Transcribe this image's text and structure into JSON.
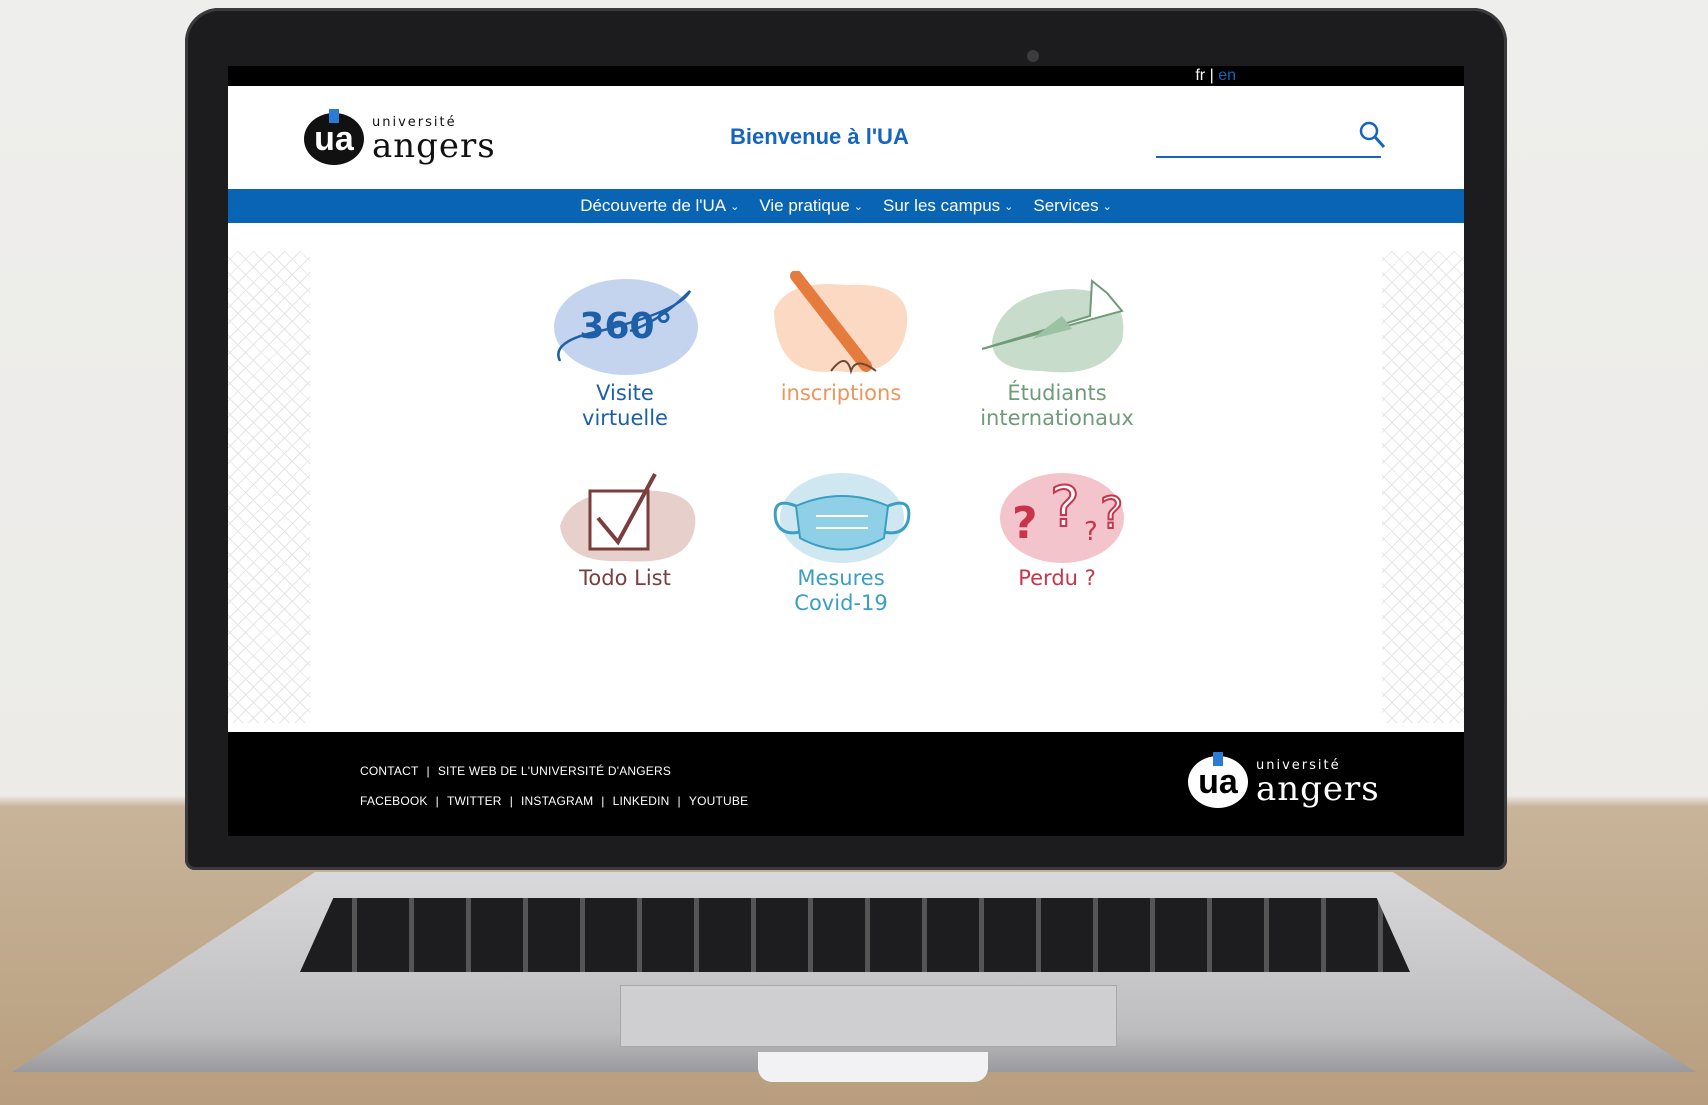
{
  "lang": {
    "fr": "fr",
    "sep": "|",
    "en": "en"
  },
  "header": {
    "logo_small": "université",
    "logo_big": "angers",
    "logo_mark": "ua",
    "welcome": "Bienvenue à l'UA",
    "search_placeholder": ""
  },
  "nav": [
    {
      "label": "Découverte de l'UA"
    },
    {
      "label": "Vie pratique"
    },
    {
      "label": "Sur les campus"
    },
    {
      "label": "Services"
    }
  ],
  "tiles": [
    {
      "line1": "Visite",
      "line2": "virtuelle",
      "color": "#1d5fa8",
      "icon_text": "360°"
    },
    {
      "line1": "inscriptions",
      "line2": "",
      "color": "#f0955a"
    },
    {
      "line1": "Étudiants",
      "line2": "internationaux",
      "color": "#6f9b78"
    },
    {
      "line1": "Todo List",
      "line2": "",
      "color": "#7a3e3e"
    },
    {
      "line1": "Mesures",
      "line2": "Covid-19",
      "color": "#3a9fc2"
    },
    {
      "line1": "Perdu ?",
      "line2": "",
      "color": "#c9344a"
    }
  ],
  "footer": {
    "row1": [
      "CONTACT",
      "SITE WEB DE L'UNIVERSITÉ D'ANGERS"
    ],
    "row2": [
      "FACEBOOK",
      "TWITTER",
      "INSTAGRAM",
      "LINKEDIN",
      "YOUTUBE"
    ],
    "separator": "|",
    "logo_small": "université",
    "logo_big": "angers",
    "logo_mark": "ua"
  }
}
